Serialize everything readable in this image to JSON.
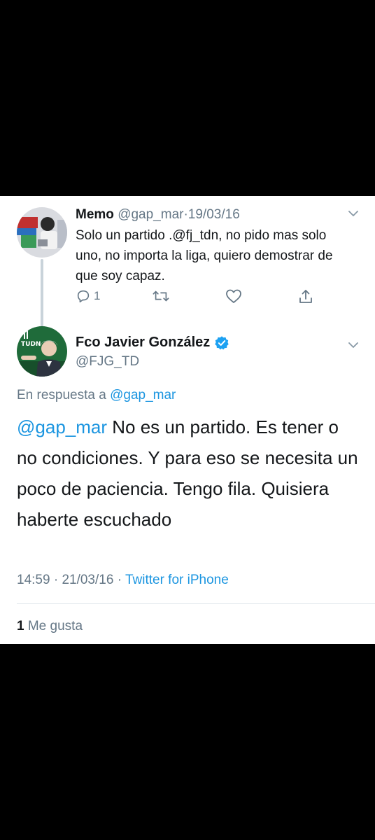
{
  "reply_thread": {
    "parent_tweet": {
      "display_name": "Memo",
      "handle": "@gap_mar",
      "separator": "·",
      "date": "19/03/16",
      "text": "Solo un partido .@fj_tdn, no pido mas solo uno, no importa la liga, quiero demostrar de que soy capaz.",
      "reply_count": "1",
      "icons": [
        "reply-icon",
        "retweet-icon",
        "like-icon",
        "share-icon",
        "chevron-down-icon"
      ]
    },
    "main_tweet": {
      "display_name": "Fco Javier González",
      "handle": "@FJG_TD",
      "verified": true,
      "avatar_badge": "TUDN",
      "reply_prefix": "En respuesta a",
      "reply_to": "@gap_mar",
      "mention": "@gap_mar",
      "text": "No es un partido. Es tener o no condiciones. Y para eso se necesita un poco de paciencia. Tengo fila. Quisiera haberte escuchado",
      "time": "14:59",
      "separator": "·",
      "date": "21/03/16",
      "source_separator": "·",
      "source": "Twitter for iPhone",
      "like_count": "1",
      "like_label": "Me gusta"
    },
    "colors": {
      "link": "#1b95e0",
      "muted": "#657786",
      "text": "#14171a",
      "verified": "#1da1f2",
      "avatar_green": "#1f6b3a"
    }
  }
}
